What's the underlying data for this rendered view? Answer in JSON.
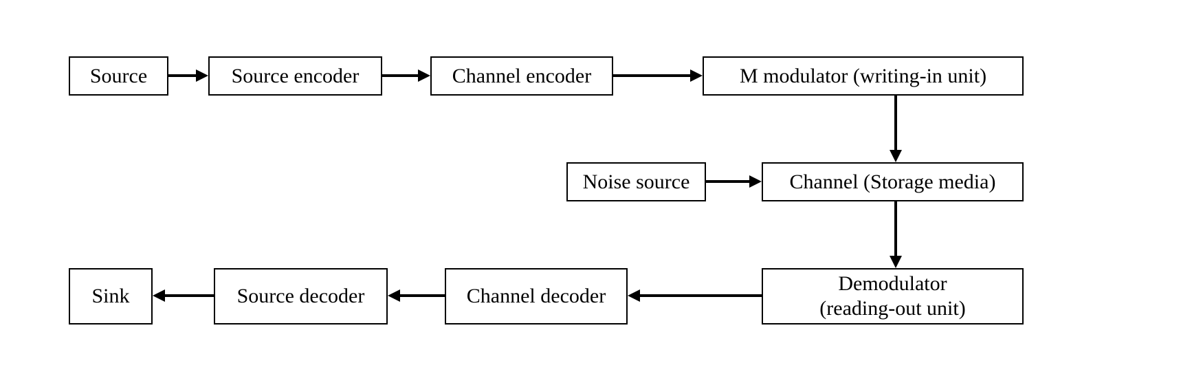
{
  "blocks": {
    "source": "Source",
    "source_encoder": "Source encoder",
    "channel_encoder": "Channel encoder",
    "modulator": "M modulator (writing-in unit)",
    "noise_source": "Noise source",
    "channel": "Channel (Storage media)",
    "demodulator_line1": "Demodulator",
    "demodulator_line2": "(reading-out unit)",
    "channel_decoder": "Channel decoder",
    "source_decoder": "Source decoder",
    "sink": "Sink"
  }
}
